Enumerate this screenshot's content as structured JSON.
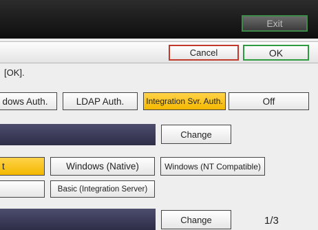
{
  "titlebar": {
    "exit_label": "Exit"
  },
  "header": {
    "cancel_label": "Cancel",
    "ok_label": "OK"
  },
  "instruction_text": "[OK].",
  "auth": {
    "windows_label": "dows Auth.",
    "ldap_label": "LDAP Auth.",
    "integration_label": "Integration Svr. Auth.",
    "off_label": "Off",
    "selected": "integration"
  },
  "section1": {
    "change_label": "Change"
  },
  "methods": {
    "selected_label": "t",
    "native_label": "Windows (Native)",
    "nt_label": "Windows (NT Compatible)",
    "blank_label": "",
    "basic_label": "Basic (Integration Server)"
  },
  "section2": {
    "change_label": "Change"
  },
  "pagination": {
    "text": "1/3"
  },
  "colors": {
    "selected_bg": "#f4b800",
    "cancel_border": "#c0392b",
    "ok_border": "#2e9a40",
    "bar_bg": "#2e2e48"
  }
}
